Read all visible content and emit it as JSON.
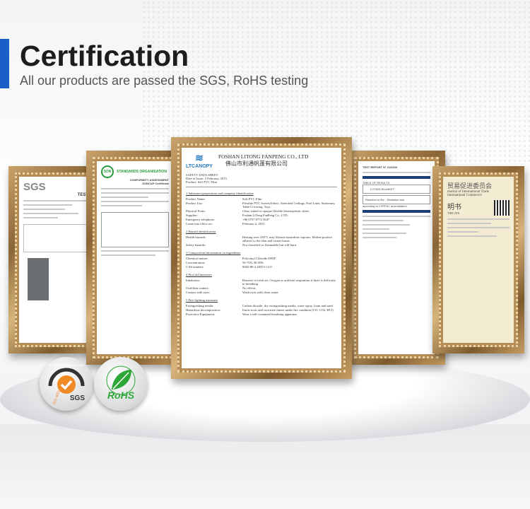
{
  "header": {
    "title": "Certification",
    "subtitle": "All our products are passed the SGS, RoHS testing"
  },
  "certificates": {
    "sgs": {
      "logo": "SGS",
      "title": "TEST R"
    },
    "son": {
      "logo": "SON",
      "title": "STANDARDS ORGANISATION",
      "sub": "CONFORMITY ASSESSMENT",
      "sub2": "SONCAP Certificate"
    },
    "sds": {
      "logo": "LTCANOPY",
      "company": "FOSHAN LITONG FANPENG CO., LTD",
      "company_cn": "佛山市利通帆蓬有限公司",
      "meta": [
        "SAFETY DATA SHEET",
        "Date of Issue: 2 February, 2015",
        "Product: Self PVC Film"
      ],
      "sections": [
        {
          "title": "1   Substance/preparation and company identification",
          "rows": [
            [
              "Product Name:",
              "Soft PVC Film"
            ],
            [
              "Product Use:",
              "Flexible PVC Screen Fabric, Stretched Ceilings, Pool Liner, Stationary, Table Covering, Toys"
            ],
            [
              "Physical Form:",
              "Clear, tinted or opaque flexible thermoplastic sheet."
            ],
            [
              "Supplier:",
              "Foshan LiTong FanPeng Co., LTD."
            ],
            [
              "Emergency telephone:",
              "+86 0757 8772 5647"
            ],
            [
              "Come into effect on:",
              "February 2, 2015"
            ]
          ]
        },
        {
          "title": "2   Hazard identification",
          "rows": [
            [
              "Health hazards:",
              "Heating over 230°C may liberate hazardous vapours. Molten product adheres to the skin and causes burns."
            ],
            [
              "Safety hazards:",
              "Not classified as flammable but will burn."
            ]
          ]
        },
        {
          "title": "3   Composition/information on ingredients",
          "rows": [
            [
              "Chemical nature:",
              "Polyvinyl Chloride   DINP"
            ],
            [
              "Concentration:",
              "50-70%   30-50%"
            ],
            [
              "CAS number:",
              "9002-86-2   28553-12-0"
            ]
          ]
        },
        {
          "title": "4   First aid measures",
          "rows": [
            [
              "Inhalation:",
              "Remove to fresh air. Oxygen or artificial respiration if there is difficulty in breathing"
            ],
            [
              "Oral/skin contact:",
              "No effects"
            ],
            [
              "Contact with eyes:",
              "Wash eyes with clean water"
            ]
          ]
        },
        {
          "title": "5   Fire-fighting measures",
          "rows": [
            [
              "Extinguishing media:",
              "Carbon dioxide, dry extinguishing media, water spray, foam and sand"
            ],
            [
              "Hazardous decomposition:",
              "Emits toxic and corrosive fumes under fire condition (CO, CO2, HCl)"
            ],
            [
              "Protective Equipment:",
              "Wear a self-contained breathing apparatus"
            ]
          ]
        }
      ]
    },
    "report": {
      "title": "TEST REPORT N° 21/2620",
      "band1": "TABLE OF RESULTS",
      "item": "LITONG BLANKET",
      "result": "Reaction to fire - Radiation test",
      "note": "according to CSPFAC accreditation"
    },
    "ccpit": {
      "title_cn": "贸易促进委员会",
      "line1": "motion of International Trade",
      "line2": "International Commerce",
      "cert_cn": "明书",
      "cert": "TIFICATE"
    }
  },
  "badges": {
    "sgs": {
      "ring": "SYSTEM CERTIFICATION",
      "iso": "ISO 9001",
      "name": "SGS"
    },
    "rohs": {
      "name": "RoHS"
    }
  },
  "colors": {
    "accent": "#1a5fc8",
    "sgs_orange": "#f08a24",
    "rohs_green": "#2da838"
  }
}
